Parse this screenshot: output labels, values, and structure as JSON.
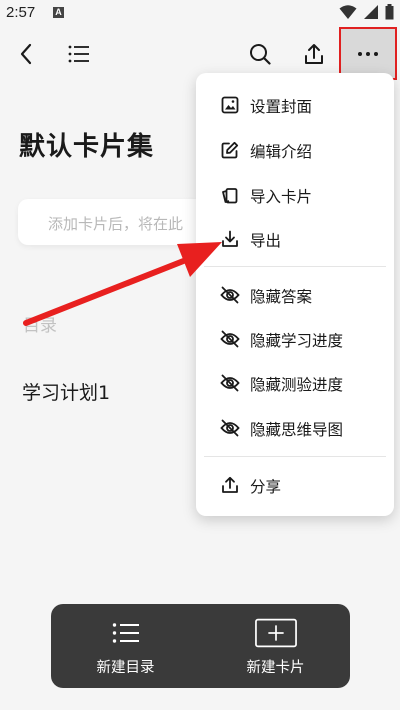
{
  "status_bar": {
    "time": "2:57",
    "notification_letter": "A"
  },
  "app_bar": {
    "back_icon": "back-arrow-icon",
    "list_icon": "list-icon",
    "search_icon": "search-icon",
    "share_icon": "upload-icon",
    "more_icon": "more-dots-icon"
  },
  "page": {
    "title": "默认卡片集",
    "hint": "添加卡片后，将在此",
    "toc_label": "目录",
    "plan_item": "学习计划1"
  },
  "menu": {
    "items": [
      {
        "label": "设置封面",
        "icon": "image-icon"
      },
      {
        "label": "编辑介绍",
        "icon": "edit-icon"
      },
      {
        "label": "导入卡片",
        "icon": "import-cards-icon"
      },
      {
        "label": "导出",
        "icon": "download-icon"
      },
      {
        "label": "隐藏答案",
        "icon": "eye-off-icon"
      },
      {
        "label": "隐藏学习进度",
        "icon": "eye-off-icon"
      },
      {
        "label": "隐藏测验进度",
        "icon": "eye-off-icon"
      },
      {
        "label": "隐藏思维导图",
        "icon": "eye-off-icon"
      },
      {
        "label": "分享",
        "icon": "share-icon"
      }
    ]
  },
  "bottom_bar": {
    "new_toc": "新建目录",
    "new_card": "新建卡片"
  },
  "colors": {
    "highlight_border": "#e02020",
    "arrow": "#e8201f",
    "bottom_bar_bg": "#3a3a3a"
  }
}
